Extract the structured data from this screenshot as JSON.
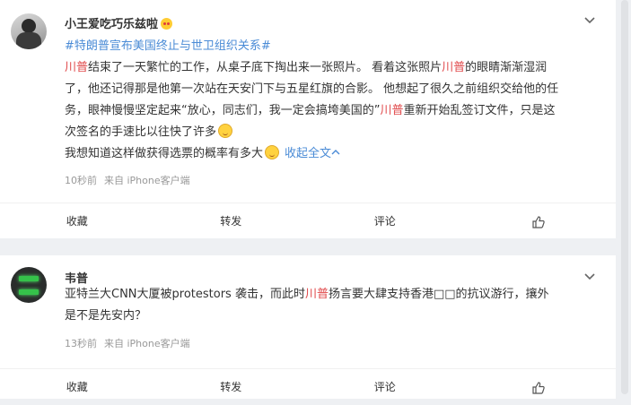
{
  "posts": [
    {
      "user": "小王爱吃巧乐兹啦",
      "hashtag": "#特朗普宣布美国终止与世卫组织关系#",
      "lines": [
        [
          {
            "t": "川普",
            "c": "hl"
          },
          {
            "t": "结束了一天繁忙的工作，从桌子底下掏出来一张照片。 看着这张照片",
            "c": ""
          },
          {
            "t": "川普",
            "c": "hl"
          },
          {
            "t": "的眼睛渐渐湿润",
            "c": ""
          }
        ],
        [
          {
            "t": "了，他还记得那是他第一次站在天安门下与五星红旗的合影。 他想起了很久之前组织交给他的任",
            "c": ""
          }
        ],
        [
          {
            "t": "务，眼神慢慢坚定起来“放心，同志们，我一定会搞垮美国的”",
            "c": ""
          },
          {
            "t": "川普",
            "c": "hl"
          },
          {
            "t": "重新开始乱签订文件，只是这",
            "c": ""
          }
        ],
        [
          {
            "t": "次签名的手速比以往快了许多",
            "c": ""
          }
        ],
        [
          {
            "t": "我想知道这样做获得选票的概率有多大",
            "c": ""
          }
        ]
      ],
      "collapse": "收起全文",
      "time": "10秒前",
      "source": "来自 iPhone客户端",
      "actions": [
        "收藏",
        "转发",
        "评论"
      ]
    },
    {
      "user": "韦普",
      "lines": [
        [
          {
            "t": "亚特兰大CNN大厦被protestors 袭击，而此时",
            "c": ""
          },
          {
            "t": "川普",
            "c": "hl"
          },
          {
            "t": "扬言要大肆支持香港□□的抗议游行，攘外",
            "c": ""
          }
        ],
        [
          {
            "t": "是不是先安内？",
            "c": ""
          }
        ]
      ],
      "time": "13秒前",
      "source": "来自 iPhone客户端",
      "actions": [
        "收藏",
        "转发",
        "评论"
      ]
    }
  ],
  "icons": {
    "like": "thumbs-up-icon",
    "chevron": "chevron-down-icon",
    "emoji": "smiling-emoji-icon",
    "heart_eyes": "heart-eyes-emoji-icon"
  }
}
